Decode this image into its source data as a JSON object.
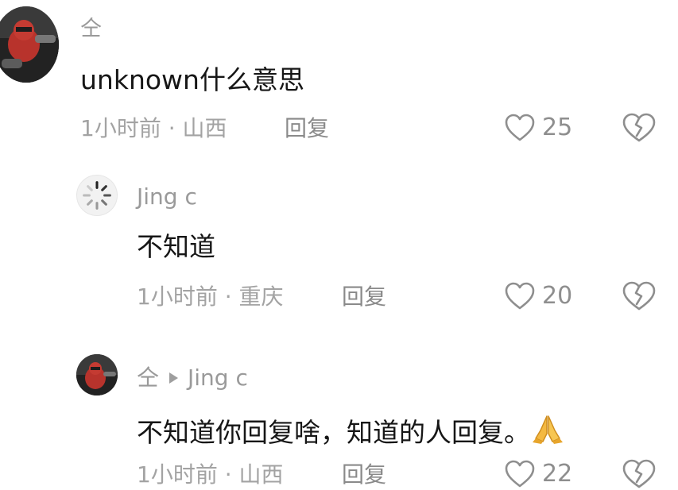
{
  "comments": [
    {
      "username": "仝",
      "text": "unknown什么意思",
      "time": "1小时前",
      "location": "山西",
      "reply_label": "回复",
      "likes": "25"
    },
    {
      "username": "Jing c",
      "text": "不知道",
      "time": "1小时前",
      "location": "重庆",
      "reply_label": "回复",
      "likes": "20"
    },
    {
      "username": "仝",
      "reply_to": "Jing c",
      "text": "不知道你回复啥，知道的人回复。",
      "time": "1小时前",
      "location": "山西",
      "reply_label": "回复",
      "likes": "22"
    }
  ],
  "separator": "·",
  "icons": {
    "like": "heart-outline-icon",
    "dislike": "broken-heart-icon",
    "reply_arrow": "triangle-right-icon",
    "emoji": "folded-hands-emoji",
    "avatar_loading": "loading-spinner-icon"
  },
  "colors": {
    "text": "#161616",
    "secondary": "#9a9a9a",
    "icon": "#8e8e8e",
    "emoji": "#f4b942"
  }
}
